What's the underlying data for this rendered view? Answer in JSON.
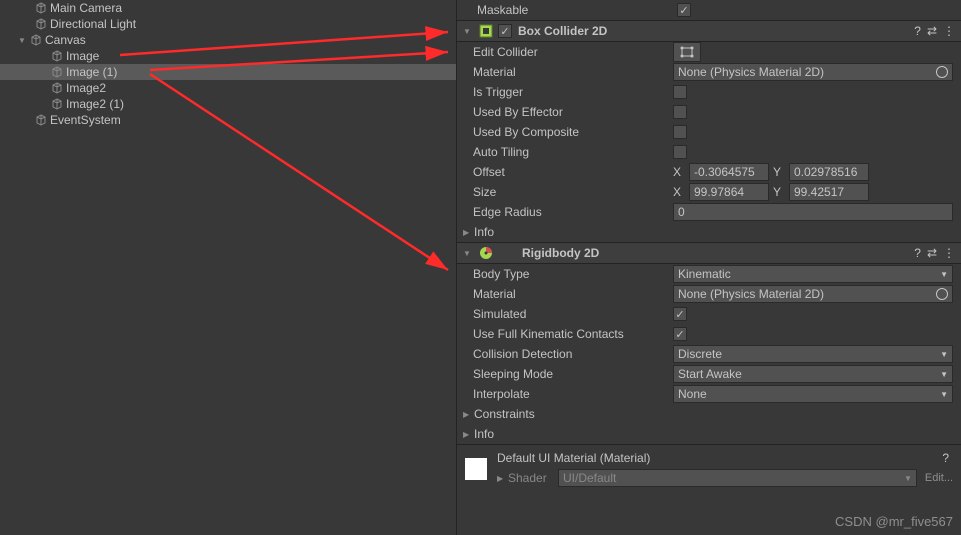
{
  "hierarchy": {
    "items": [
      {
        "name": "Main Camera",
        "indent": 2,
        "arrow": ""
      },
      {
        "name": "Directional Light",
        "indent": 2,
        "arrow": ""
      },
      {
        "name": "Canvas",
        "indent": 1,
        "arrow": "▼"
      },
      {
        "name": "Image",
        "indent": 2,
        "arrow": ""
      },
      {
        "name": "Image (1)",
        "indent": 2,
        "arrow": "",
        "selected": true
      },
      {
        "name": "Image2",
        "indent": 2,
        "arrow": ""
      },
      {
        "name": "Image2 (1)",
        "indent": 2,
        "arrow": ""
      },
      {
        "name": "EventSystem",
        "indent": 1,
        "arrow": ""
      }
    ]
  },
  "inspector": {
    "maskable": {
      "label": "Maskable",
      "checked": true
    },
    "box_collider": {
      "title": "Box Collider 2D",
      "enabled": true,
      "edit_collider": "Edit Collider",
      "material_label": "Material",
      "material_value": "None (Physics Material 2D)",
      "is_trigger": "Is Trigger",
      "used_by_effector": "Used By Effector",
      "used_by_composite": "Used By Composite",
      "auto_tiling": "Auto Tiling",
      "offset_label": "Offset",
      "offset_x": "-0.3064575",
      "offset_y": "0.02978516",
      "size_label": "Size",
      "size_x": "99.97864",
      "size_y": "99.42517",
      "edge_radius_label": "Edge Radius",
      "edge_radius": "0",
      "info": "Info"
    },
    "rigidbody": {
      "title": "Rigidbody 2D",
      "body_type_label": "Body Type",
      "body_type": "Kinematic",
      "material_label": "Material",
      "material_value": "None (Physics Material 2D)",
      "simulated": "Simulated",
      "use_full": "Use Full Kinematic Contacts",
      "collision_label": "Collision Detection",
      "collision_value": "Discrete",
      "sleeping_label": "Sleeping Mode",
      "sleeping_value": "Start Awake",
      "interpolate_label": "Interpolate",
      "interpolate_value": "None",
      "constraints": "Constraints",
      "info": "Info"
    },
    "material": {
      "title": "Default UI Material (Material)",
      "shader_label": "Shader",
      "shader_value": "UI/Default"
    },
    "labels": {
      "x": "X",
      "y": "Y"
    },
    "edit": "Edit..."
  },
  "watermark": "CSDN @mr_five567"
}
